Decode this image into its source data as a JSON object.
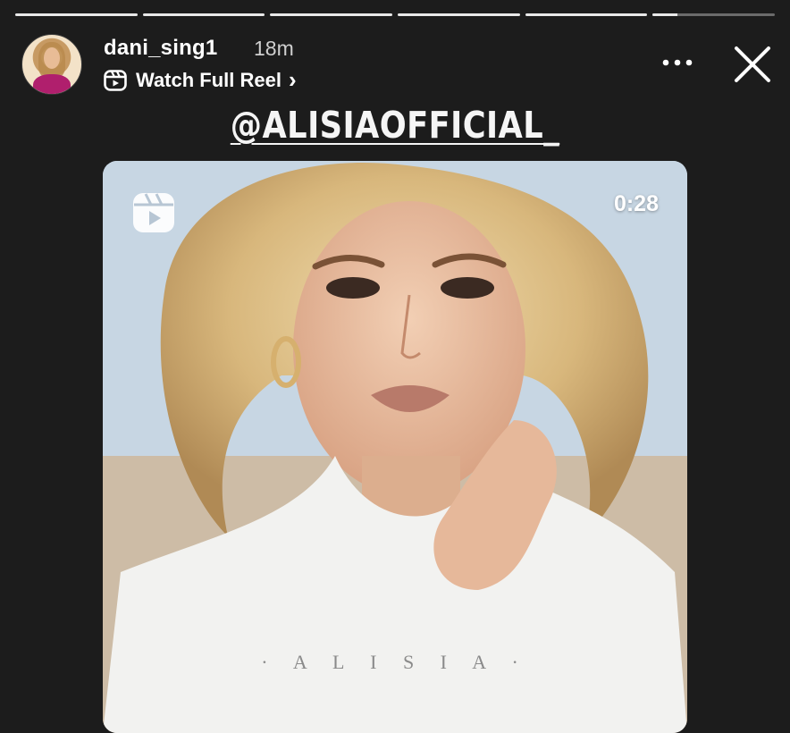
{
  "story": {
    "progress_segments": [
      1,
      1,
      1,
      1,
      1,
      0.2
    ]
  },
  "header": {
    "username": "dani_sing1",
    "time_ago": "18m",
    "reel_link_label": "Watch Full Reel",
    "reel_link_chevron": "›",
    "more_icon": "more-horizontal-icon",
    "close_icon": "close-icon"
  },
  "mention": {
    "text": "@ALISIAOFFICIAL_"
  },
  "reel_card": {
    "duration": "0:28",
    "caption": "· A L I S I A ·",
    "reel_icon": "reels-icon"
  },
  "colors": {
    "background": "#1c1c1c",
    "text": "#ffffff",
    "secondary_text": "#cfcfcf"
  }
}
